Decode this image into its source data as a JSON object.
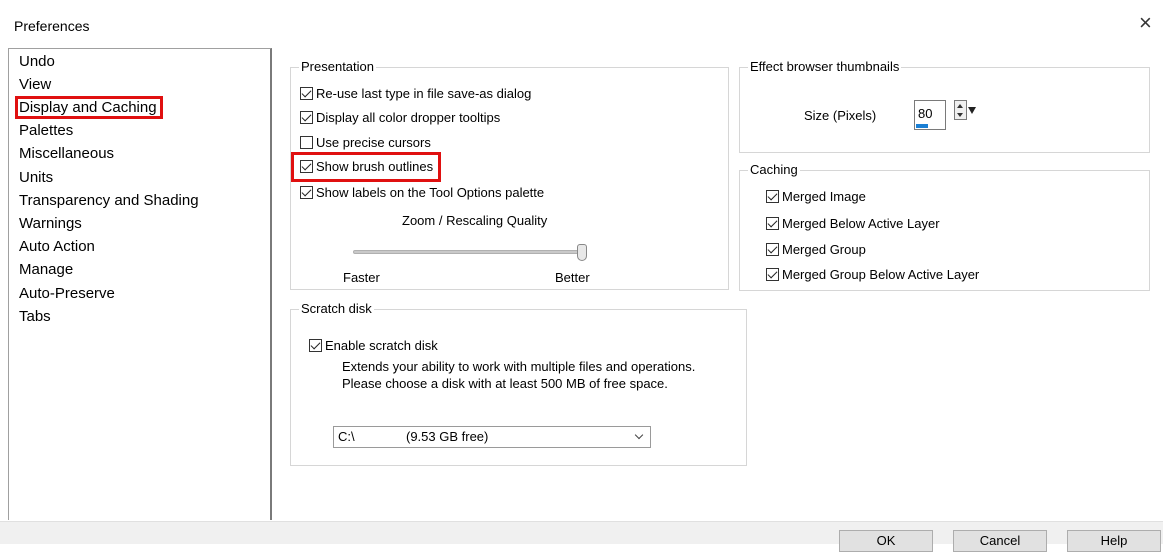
{
  "window": {
    "title": "Preferences",
    "close_glyph": "×"
  },
  "sidebar": {
    "items": [
      {
        "label": "Undo"
      },
      {
        "label": "View"
      },
      {
        "label": "Display and Caching",
        "selected": true
      },
      {
        "label": "Palettes"
      },
      {
        "label": "Miscellaneous"
      },
      {
        "label": "Units"
      },
      {
        "label": "Transparency and Shading"
      },
      {
        "label": "Warnings"
      },
      {
        "label": "Auto Action"
      },
      {
        "label": "Manage"
      },
      {
        "label": "Auto-Preserve"
      },
      {
        "label": "Tabs"
      }
    ]
  },
  "presentation": {
    "label": "Presentation",
    "options": [
      {
        "label": "Re-use last type in file save-as dialog",
        "checked": true
      },
      {
        "label": "Display all color dropper tooltips",
        "checked": true
      },
      {
        "label": "Use precise cursors",
        "checked": false
      },
      {
        "label": "Show brush outlines",
        "checked": true,
        "highlighted": true
      },
      {
        "label": "Show labels on the Tool Options palette",
        "checked": true
      }
    ],
    "zoom_label": "Zoom / Rescaling Quality",
    "slider_min_label": "Faster",
    "slider_max_label": "Better",
    "slider_value": 1.0
  },
  "thumbnails": {
    "label": "Effect browser thumbnails",
    "size_label": "Size (Pixels)",
    "size_value": "80"
  },
  "caching": {
    "label": "Caching",
    "options": [
      {
        "label": "Merged Image",
        "checked": true
      },
      {
        "label": "Merged Below Active Layer",
        "checked": true
      },
      {
        "label": "Merged Group",
        "checked": true
      },
      {
        "label": "Merged Group Below Active Layer",
        "checked": true
      }
    ]
  },
  "scratch": {
    "label": "Scratch disk",
    "enable_label": "Enable scratch disk",
    "enable_checked": true,
    "desc_line1": "Extends your ability to work with multiple files and operations.",
    "desc_line2": "Please choose a disk with at least 500 MB of free space.",
    "drive": "C:\\",
    "free_space": "(9.53 GB free)"
  },
  "footer": {
    "ok_label": "OK",
    "cancel_label": "Cancel",
    "help_label": "Help"
  },
  "colors": {
    "highlight": "#e01010",
    "accent": "#1a7fd4"
  }
}
